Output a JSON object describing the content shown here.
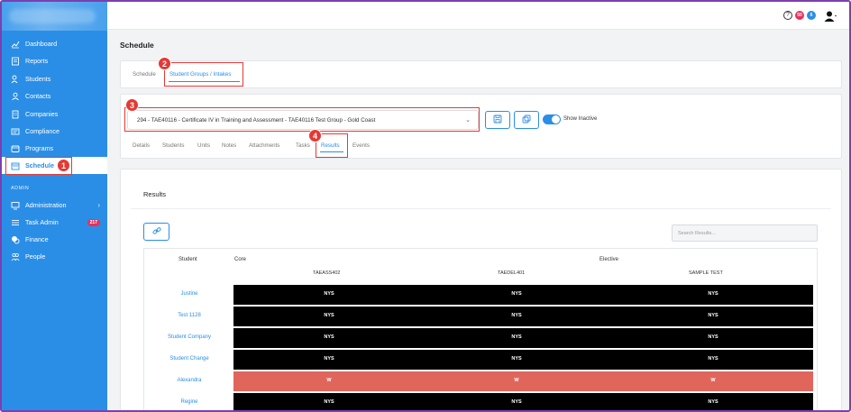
{
  "sidebar": {
    "items": [
      {
        "label": "Dashboard",
        "icon": "chart-line-icon"
      },
      {
        "label": "Reports",
        "icon": "report-icon"
      },
      {
        "label": "Students",
        "icon": "students-icon"
      },
      {
        "label": "Contacts",
        "icon": "contacts-icon"
      },
      {
        "label": "Companies",
        "icon": "building-icon"
      },
      {
        "label": "Compliance",
        "icon": "compliance-icon"
      },
      {
        "label": "Programs",
        "icon": "programs-icon"
      },
      {
        "label": "Schedule",
        "icon": "calendar-icon",
        "active": true
      }
    ],
    "admin_label": "ADMIN",
    "admin_items": [
      {
        "label": "Administration",
        "icon": "monitor-icon"
      },
      {
        "label": "Task Admin",
        "icon": "list-icon",
        "badge": "217"
      },
      {
        "label": "Finance",
        "icon": "coins-icon"
      },
      {
        "label": "People",
        "icon": "people-icon"
      }
    ]
  },
  "topbar": {
    "help": "?",
    "badge1": "50",
    "badge2": "6"
  },
  "page_title": "Schedule",
  "tabs_top": [
    "Schedule",
    "Student Groups / Intakes"
  ],
  "group_select": "294 - TAE40116 - Certificate IV in Training and Assessment - TAE40116 Test Group - Gold Coast",
  "show_inactive_label": "Show Inactive",
  "subtabs": [
    "Details",
    "Students",
    "Units",
    "Notes",
    "Attachments",
    "Tasks",
    "Results",
    "Events"
  ],
  "results": {
    "title": "Results",
    "search_placeholder": "Search Results...",
    "header_student": "Student",
    "header_core": "Core",
    "header_elective": "Elective",
    "units": [
      "TAEASS402",
      "TAEDEL401",
      "SAMPLE TEST"
    ],
    "rows": [
      {
        "name": "Justine",
        "values": [
          "NYS",
          "NYS",
          "NYS"
        ]
      },
      {
        "name": "Test 1128",
        "values": [
          "NYS",
          "NYS",
          "NYS"
        ]
      },
      {
        "name": "Student Company",
        "values": [
          "NYS",
          "NYS",
          "NYS"
        ]
      },
      {
        "name": "Student Change",
        "values": [
          "NYS",
          "NYS",
          "NYS"
        ]
      },
      {
        "name": "Alexandra",
        "values": [
          "W",
          "W",
          "W"
        ],
        "highlight": "#e0665c"
      },
      {
        "name": "Regine",
        "values": [
          "NYS",
          "NYS",
          "NYS"
        ]
      }
    ]
  },
  "callouts": [
    "1",
    "2",
    "3",
    "4"
  ],
  "colors": {
    "accent": "#2a8ee6",
    "callout": "#e53935",
    "withdrawn_row": "#e0665c"
  }
}
